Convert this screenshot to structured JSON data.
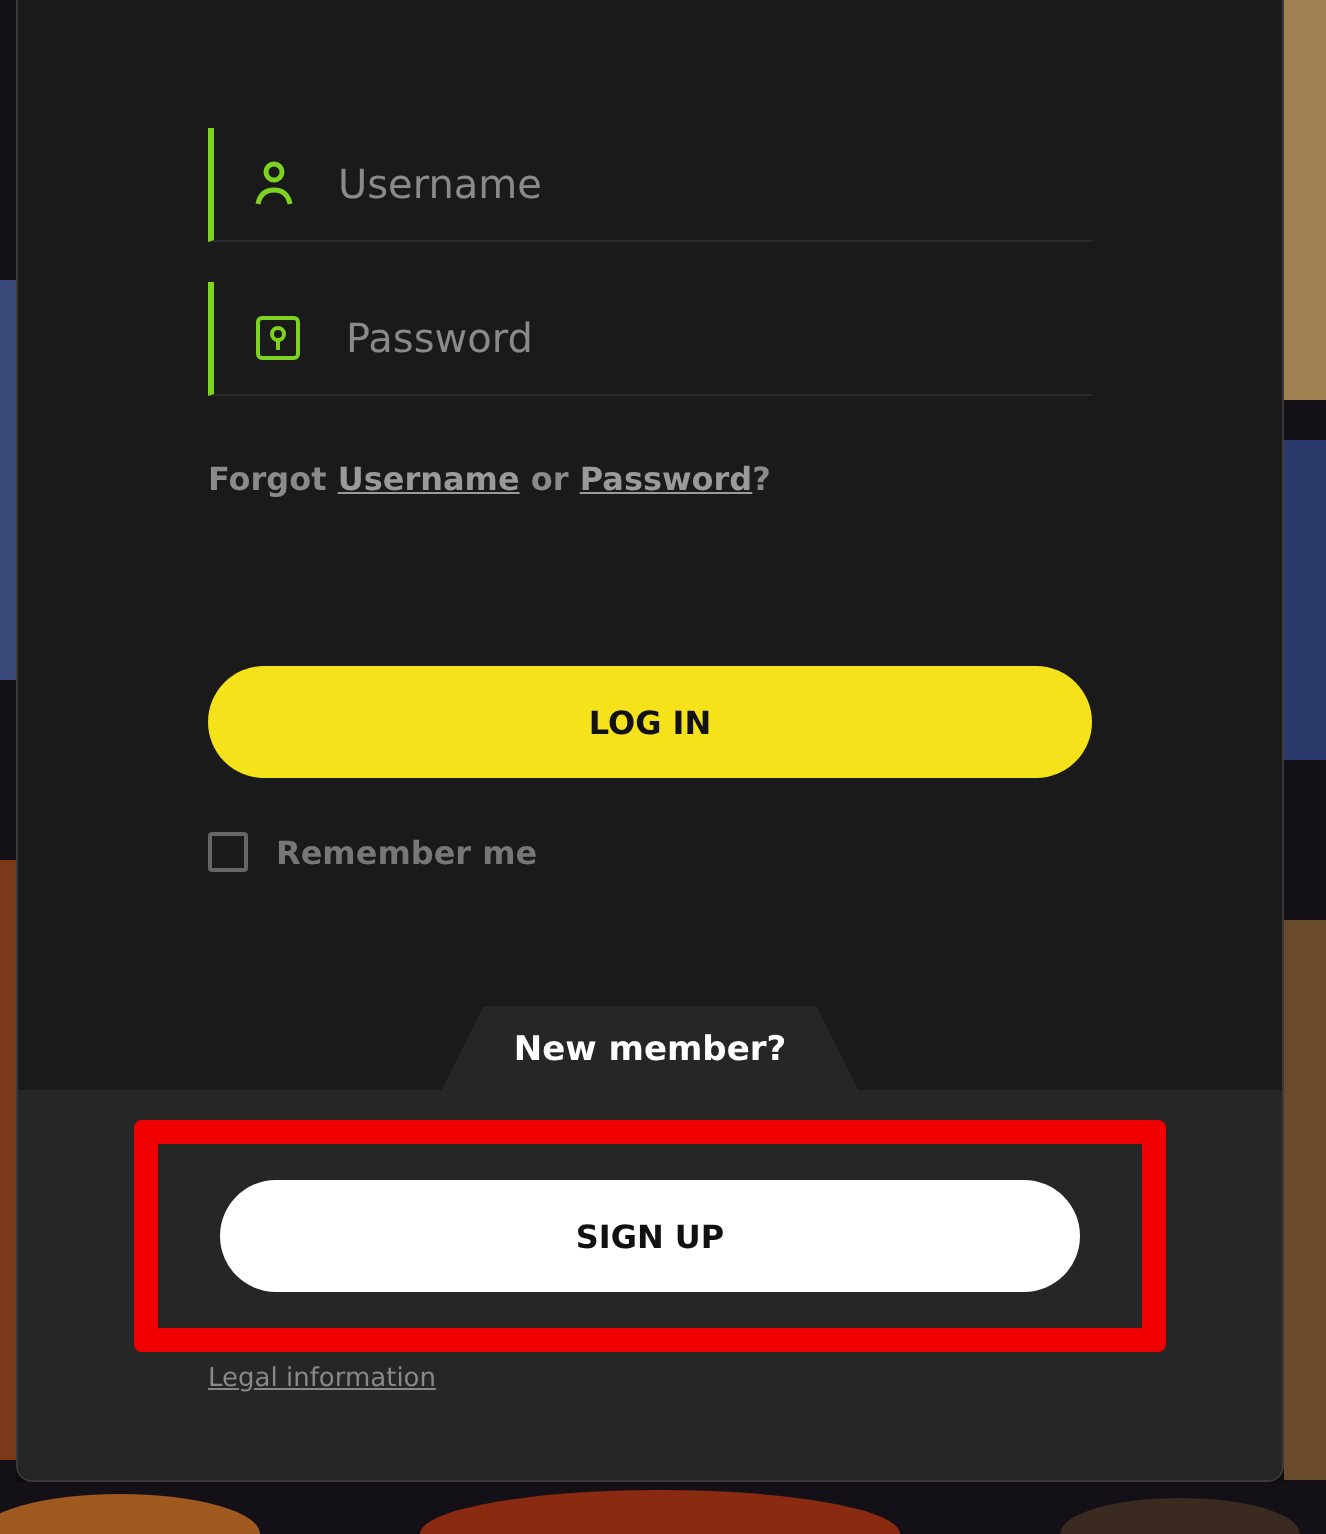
{
  "fields": [
    {
      "kind": "user",
      "placeholder": "Username"
    },
    {
      "kind": "password",
      "placeholder": "Password"
    }
  ],
  "forgot": {
    "prefix": "Forgot",
    "username_link": "Username",
    "middle": "or",
    "password_link": "Password",
    "suffix": "?"
  },
  "login_button": "LOG IN",
  "remember": {
    "label": "Remember me",
    "checked": false
  },
  "new_member": "New member?",
  "signup_button": "SIGN UP",
  "signup_highlighted": true,
  "legal_link": "Legal information"
}
